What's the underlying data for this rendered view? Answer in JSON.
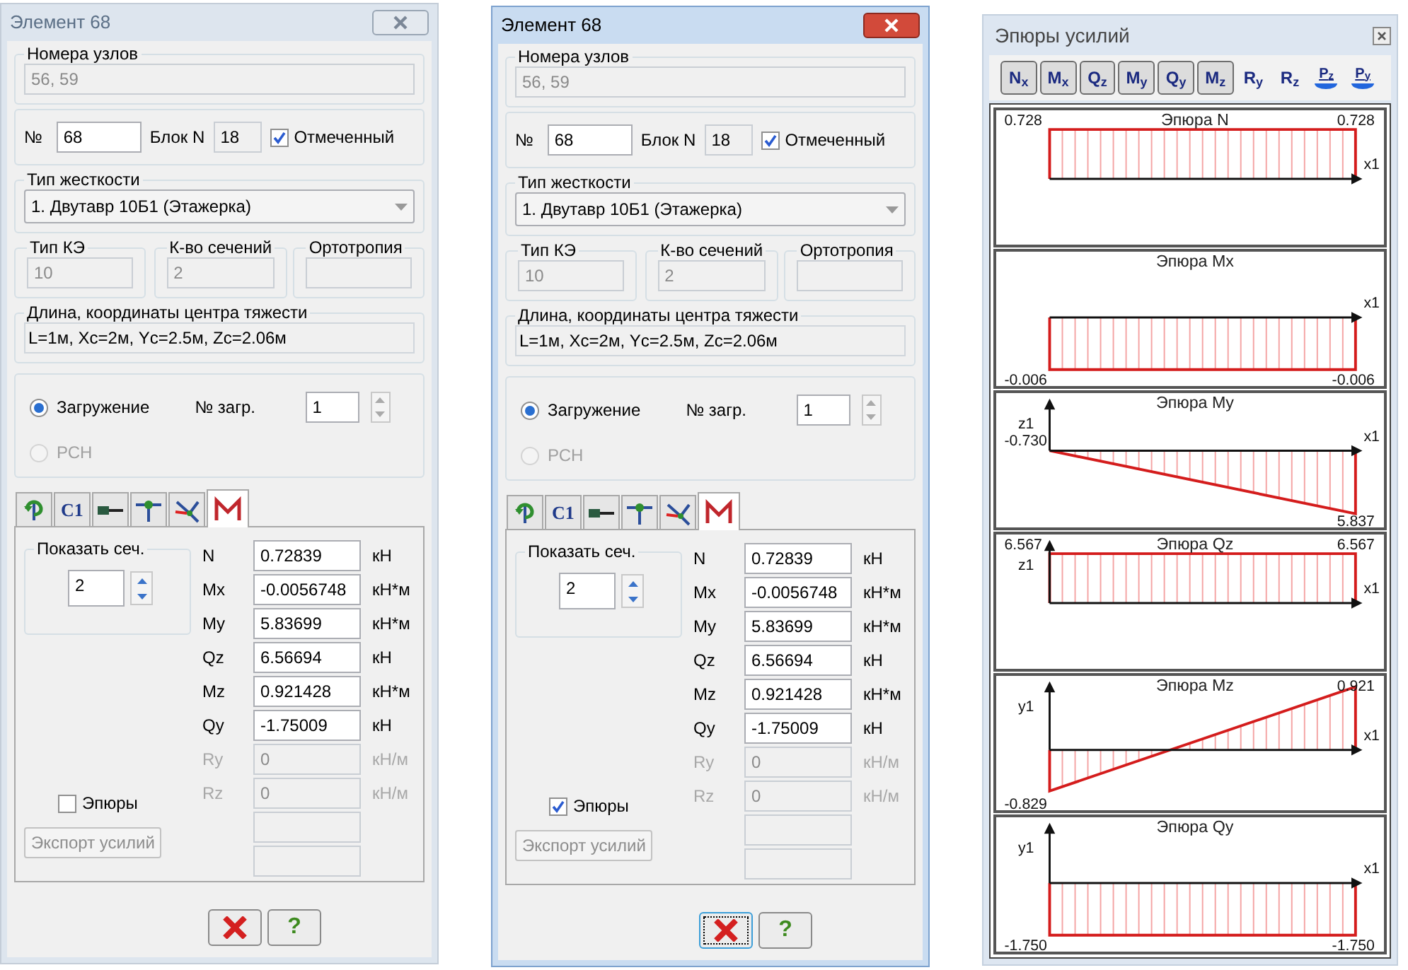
{
  "dialogs": [
    {
      "title": "Элемент 68",
      "active": false,
      "nodes_label": "Номера узлов",
      "nodes": "56, 59",
      "number_label": "№",
      "number": "68",
      "block_label": "Блок N",
      "block": "18",
      "marked": {
        "label": "Отмеченный",
        "checked": true
      },
      "stiffness_label": "Тип жесткости",
      "stiffness": "1. Двутавр 10Б1 (Этажерка)",
      "info": [
        {
          "label": "Тип КЭ",
          "value": "10"
        },
        {
          "label": "К-во сечений",
          "value": "2"
        },
        {
          "label": "Ортотропия"
        }
      ],
      "geometry_label": "Длина, координаты центра тяжести",
      "geometry": "L=1м, Xc=2м, Yc=2.5м, Zc=2.06м",
      "radios": [
        {
          "label": "Загружение",
          "selected": true,
          "disabled": false
        },
        {
          "label": "РСН",
          "selected": false,
          "disabled": true
        }
      ],
      "load_label": "№ загр.",
      "load": "1",
      "tabs": [
        {
          "kind": "rotate",
          "selected": false
        },
        {
          "kind": "text",
          "label": "C1",
          "selected": false
        },
        {
          "kind": "beam",
          "selected": false
        },
        {
          "kind": "support",
          "selected": false
        },
        {
          "kind": "axes",
          "selected": false
        },
        {
          "kind": "diagram",
          "selected": true
        }
      ],
      "section_label": "Показать сеч.",
      "section": "2",
      "forces": [
        {
          "label": "N",
          "value": "0.72839",
          "unit": "кН",
          "disabled": false
        },
        {
          "label": "Mx",
          "value": "-0.0056748",
          "unit": "кН*м",
          "disabled": false
        },
        {
          "label": "My",
          "value": "5.83699",
          "unit": "кН*м",
          "disabled": false
        },
        {
          "label": "Qz",
          "value": "6.56694",
          "unit": "кН",
          "disabled": false
        },
        {
          "label": "Mz",
          "value": "0.921428",
          "unit": "кН*м",
          "disabled": false
        },
        {
          "label": "Qy",
          "value": "-1.75009",
          "unit": "кН",
          "disabled": false
        },
        {
          "label": "Ry",
          "value": "0",
          "unit": "кН/м",
          "disabled": true
        },
        {
          "label": "Rz",
          "value": "0",
          "unit": "кН/м",
          "disabled": true
        },
        {
          "disabled": true
        },
        {
          "disabled": true
        }
      ],
      "diagrams_checkbox": {
        "label": "Эпюры",
        "checked": false
      },
      "export_button": {
        "label": "Экспорт усилий",
        "disabled": true
      },
      "cancel_focused": false,
      "help_label": "?"
    },
    {
      "title": "Элемент 68",
      "active": true,
      "nodes_label": "Номера узлов",
      "nodes": "56, 59",
      "number_label": "№",
      "number": "68",
      "block_label": "Блок N",
      "block": "18",
      "marked": {
        "label": "Отмеченный",
        "checked": true
      },
      "stiffness_label": "Тип жесткости",
      "stiffness": "1. Двутавр 10Б1 (Этажерка)",
      "info": [
        {
          "label": "Тип КЭ",
          "value": "10"
        },
        {
          "label": "К-во сечений",
          "value": "2"
        },
        {
          "label": "Ортотропия"
        }
      ],
      "geometry_label": "Длина, координаты центра тяжести",
      "geometry": "L=1м, Xc=2м, Yc=2.5м, Zc=2.06м",
      "radios": [
        {
          "label": "Загружение",
          "selected": true,
          "disabled": false
        },
        {
          "label": "РСН",
          "selected": false,
          "disabled": true
        }
      ],
      "load_label": "№ загр.",
      "load": "1",
      "tabs": [
        {
          "kind": "rotate",
          "selected": false
        },
        {
          "kind": "text",
          "label": "C1",
          "selected": false
        },
        {
          "kind": "beam",
          "selected": false
        },
        {
          "kind": "support",
          "selected": false
        },
        {
          "kind": "axes",
          "selected": false
        },
        {
          "kind": "diagram",
          "selected": true
        }
      ],
      "section_label": "Показать сеч.",
      "section": "2",
      "forces": [
        {
          "label": "N",
          "value": "0.72839",
          "unit": "кН",
          "disabled": false
        },
        {
          "label": "Mx",
          "value": "-0.0056748",
          "unit": "кН*м",
          "disabled": false
        },
        {
          "label": "My",
          "value": "5.83699",
          "unit": "кН*м",
          "disabled": false
        },
        {
          "label": "Qz",
          "value": "6.56694",
          "unit": "кН",
          "disabled": false
        },
        {
          "label": "Mz",
          "value": "0.921428",
          "unit": "кН*м",
          "disabled": false
        },
        {
          "label": "Qy",
          "value": "-1.75009",
          "unit": "кН",
          "disabled": false
        },
        {
          "label": "Ry",
          "value": "0",
          "unit": "кН/м",
          "disabled": true
        },
        {
          "label": "Rz",
          "value": "0",
          "unit": "кН/м",
          "disabled": true
        },
        {
          "disabled": true
        },
        {
          "disabled": true
        }
      ],
      "diagrams_checkbox": {
        "label": "Эпюры",
        "checked": true
      },
      "export_button": {
        "label": "Экспорт усилий",
        "disabled": true
      },
      "cancel_focused": true,
      "help_label": "?"
    }
  ],
  "diagrams_panel": {
    "title": "Эпюры усилий",
    "toolbar": [
      {
        "label": "N$_{x}$",
        "kind": "toggle"
      },
      {
        "label": "M$_{x}$",
        "kind": "toggle"
      },
      {
        "label": "Q$_{z}$",
        "kind": "toggle"
      },
      {
        "label": "M$_{y}$",
        "kind": "toggle"
      },
      {
        "label": "Q$_{y}$",
        "kind": "toggle"
      },
      {
        "label": "M$_{z}$",
        "kind": "toggle"
      },
      {
        "label": "R$_{y}$",
        "kind": "plain"
      },
      {
        "label": "R$_{z}$",
        "kind": "plain"
      },
      {
        "label": "P$_{z}$",
        "kind": "load"
      },
      {
        "label": "P$_{y}$",
        "kind": "load"
      }
    ],
    "plots": [
      {
        "title": "Эпюра  N",
        "kind": "above",
        "left_value": "0.728",
        "right_value": "0.728",
        "axis_label": "x1"
      },
      {
        "title": "Эпюра Mx",
        "kind": "below",
        "left_value": "-0.006",
        "right_value": "-0.006",
        "axis_label": "x1"
      },
      {
        "title": "Эпюра My",
        "kind": "descending",
        "left_value": "-0.730",
        "right_value": "5.837",
        "axis_label": "x1",
        "vertical_axis_label": "z1"
      },
      {
        "title": "Эпюра Qz",
        "kind": "above",
        "left_value": "6.567",
        "right_value": "6.567",
        "axis_label": "x1",
        "vertical_axis_label": "z1"
      },
      {
        "title": "Эпюра Mz",
        "kind": "ascending",
        "left_value": "-0.829",
        "right_value": "0.921",
        "axis_label": "x1",
        "vertical_axis_label": "y1"
      },
      {
        "title": "Эпюра Qy",
        "kind": "below",
        "left_value": "-1.750",
        "right_value": "-1.750",
        "axis_label": "x1",
        "vertical_axis_label": "y1"
      }
    ]
  }
}
